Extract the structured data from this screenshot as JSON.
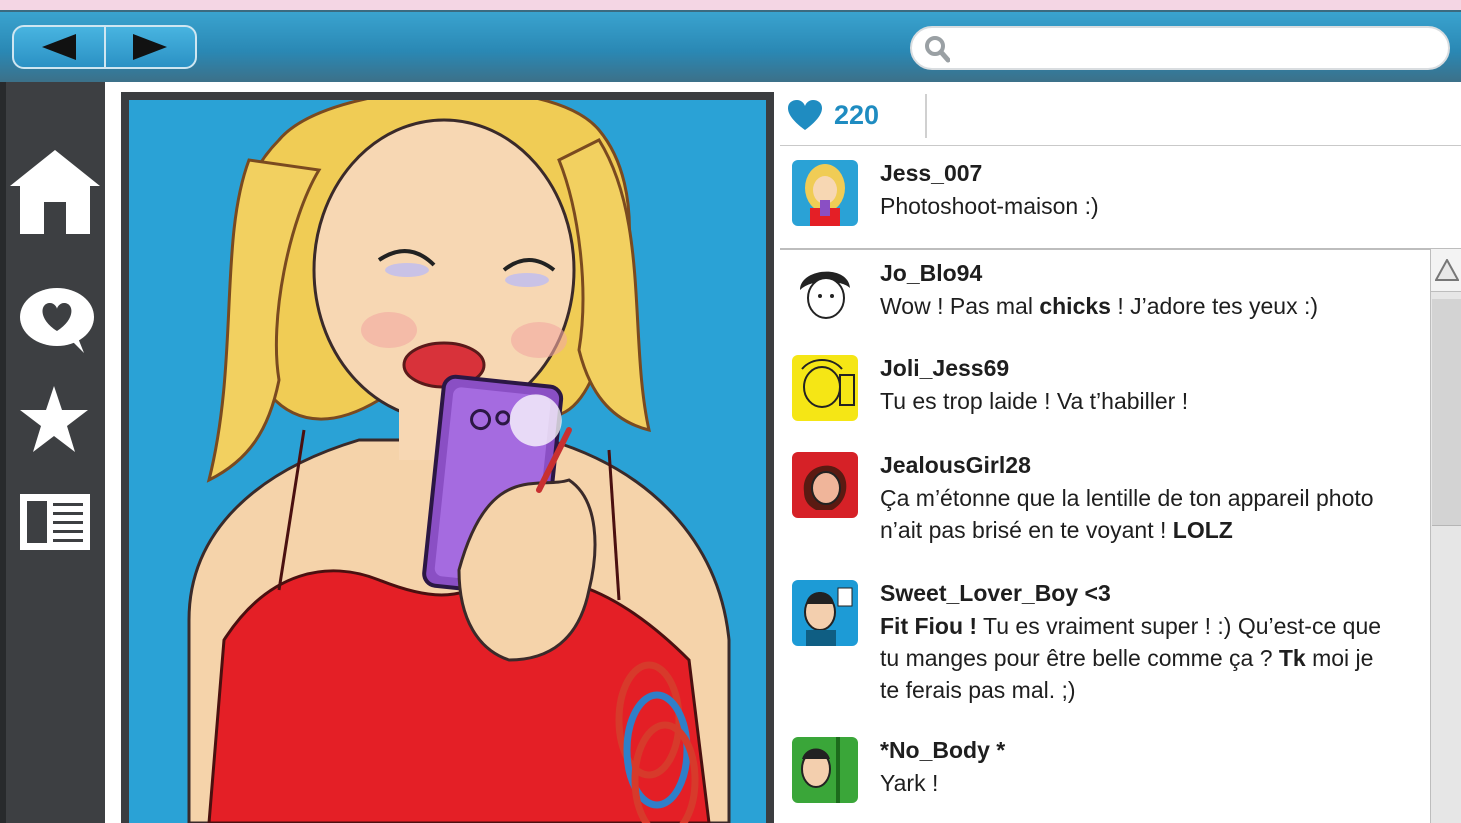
{
  "search": {
    "placeholder": ""
  },
  "likes": {
    "count": "220"
  },
  "post": {
    "author": "Jess_007",
    "caption": "Photoshoot-maison :)"
  },
  "comments": [
    {
      "user": "Jo_Blo94",
      "parts": [
        [
          "Wow ! Pas mal ",
          false
        ],
        [
          "chicks",
          true
        ],
        [
          " ! J’adore tes yeux :)",
          false
        ]
      ]
    },
    {
      "user": "Joli_Jess69",
      "parts": [
        [
          "Tu es trop laide ! Va t’habiller !",
          false
        ]
      ]
    },
    {
      "user": "JealousGirl28",
      "parts": [
        [
          "Ça m’étonne que la lentille de ton appareil photo n’ait pas brisé en te voyant ! ",
          false
        ],
        [
          "LOLZ",
          true
        ]
      ]
    },
    {
      "user": "Sweet_Lover_Boy <3",
      "parts": [
        [
          "Fit Fiou !",
          true
        ],
        [
          " Tu es vraiment super ! :) Qu’est-ce que tu manges pour être belle comme ça ? ",
          false
        ],
        [
          "Tk",
          true
        ],
        [
          " moi je te ferais pas mal. ;)",
          false
        ]
      ]
    },
    {
      "user": "*No_Body *",
      "parts": [
        [
          "Yark !",
          false
        ]
      ]
    }
  ],
  "colors": {
    "accent": "#1f8cc1",
    "sidebar": "#3d3f42",
    "topbar": "#2a88b4",
    "page_bg": "#f4d6e4"
  },
  "icons": [
    "back-arrow-icon",
    "forward-arrow-icon",
    "search-icon",
    "home-icon",
    "chat-heart-icon",
    "star-icon",
    "list-icon",
    "heart-icon"
  ]
}
